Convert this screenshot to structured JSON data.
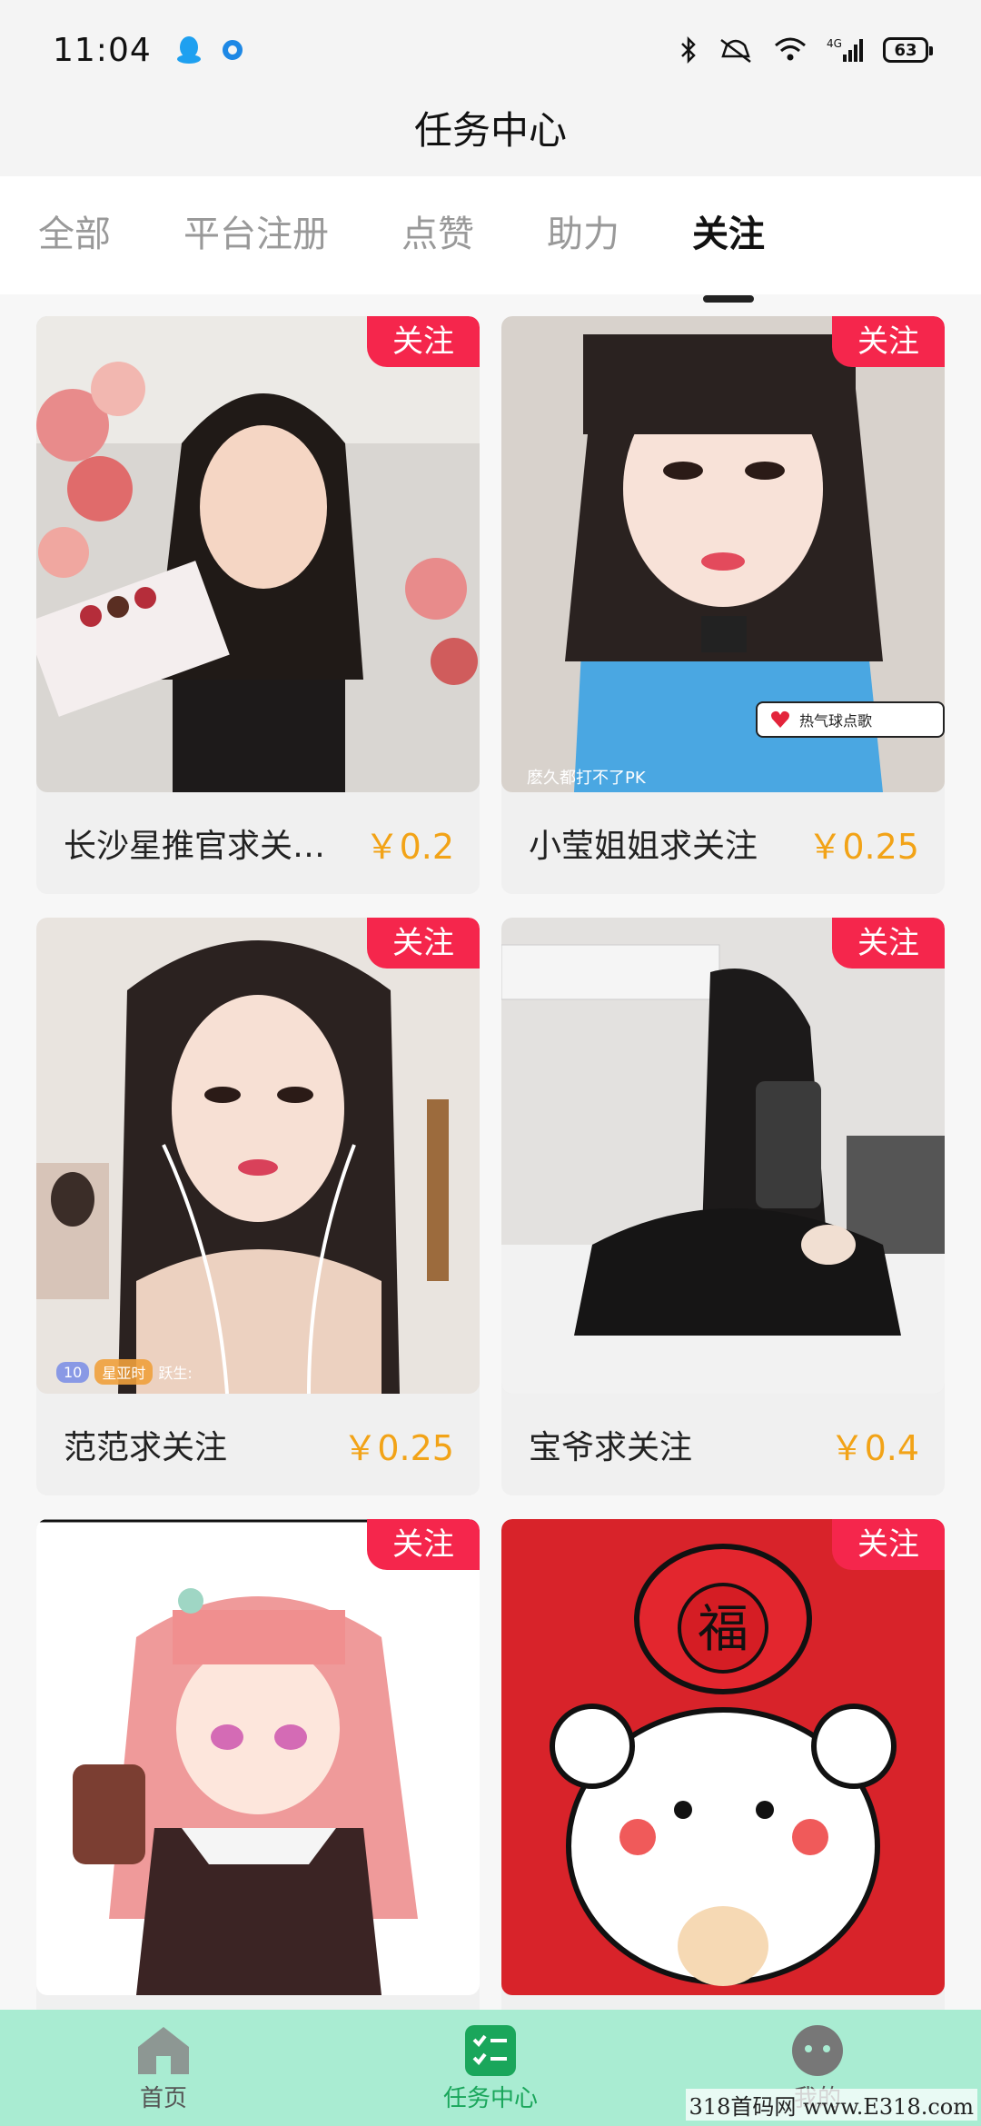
{
  "status_bar": {
    "time": "11:04",
    "battery": "63",
    "icons": [
      "qq-icon",
      "record-icon",
      "bluetooth-icon",
      "mute-icon",
      "wifi-icon",
      "signal-4g-icon",
      "battery-icon"
    ]
  },
  "header": {
    "title": "任务中心"
  },
  "tabs": [
    {
      "label": "全部"
    },
    {
      "label": "平台注册"
    },
    {
      "label": "点赞"
    },
    {
      "label": "助力"
    },
    {
      "label": "关注",
      "active": true
    }
  ],
  "cards": [
    {
      "tag": "关注",
      "title": "长沙星推官求关…",
      "price": "￥0.2"
    },
    {
      "tag": "关注",
      "title": "小莹姐姐求关注",
      "price": "￥0.25",
      "overlay_bottom": "麽久都打不了PK",
      "overlay_badge": "热气球点歌"
    },
    {
      "tag": "关注",
      "title": "范范求关注",
      "price": "￥0.25",
      "live_badges": [
        "10",
        "星亚时",
        "跃生:"
      ]
    },
    {
      "tag": "关注",
      "title": "宝爷求关注",
      "price": "￥0.4"
    },
    {
      "tag": "关注",
      "title": "",
      "price": ""
    },
    {
      "tag": "关注",
      "title": "",
      "price": "",
      "fu_char": "福"
    }
  ],
  "bottom_nav": [
    {
      "label": "首页",
      "icon": "home-icon"
    },
    {
      "label": "任务中心",
      "icon": "task-list-icon",
      "active": true
    },
    {
      "label": "我的",
      "icon": "profile-icon"
    }
  ],
  "watermark": "318首码网 www.E318.com",
  "colors": {
    "accent_green": "#1aa65b",
    "tag_red": "#f5264c",
    "price_orange": "#f2a317",
    "nav_bg": "#a9ecd2"
  }
}
